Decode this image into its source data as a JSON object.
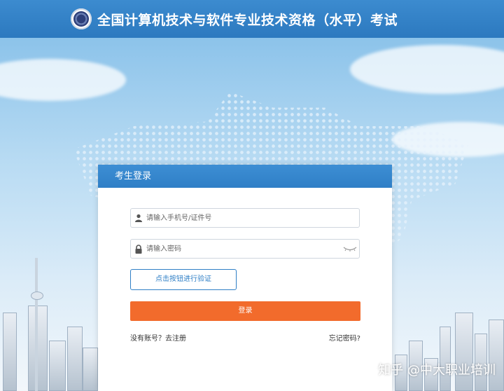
{
  "header": {
    "title": "全国计算机技术与软件专业技术资格（水平）考试"
  },
  "login_card": {
    "heading": "考生登录",
    "phone_placeholder": "请输入手机号/证件号",
    "password_placeholder": "请输入密码",
    "verify_label": "点击按钮进行验证",
    "login_label": "登录",
    "register_link": "没有账号？去注册",
    "forgot_link": "忘记密码?"
  },
  "watermark": "知乎 @中大职业培训",
  "colors": {
    "header_blue": "#2f7fc6",
    "login_orange": "#f26b2c"
  },
  "icons": [
    "user-icon",
    "lock-icon",
    "eye-hidden-icon",
    "exam-logo"
  ]
}
